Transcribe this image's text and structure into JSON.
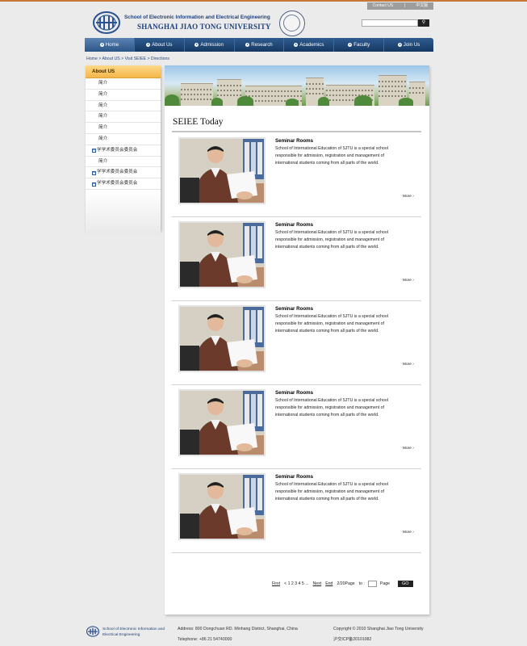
{
  "topbar": {
    "contact": "Contact US",
    "divider": "|",
    "chinese": "中文版"
  },
  "header": {
    "school": "School of Electronic Information and Electrical Engineering",
    "university": "SHANGHAI JIAO TONG UNIVERSITY"
  },
  "search": {
    "placeholder": "",
    "button": "⚲"
  },
  "nav": [
    {
      "label": "Home"
    },
    {
      "label": "About Us"
    },
    {
      "label": "Admission"
    },
    {
      "label": "Research"
    },
    {
      "label": "Academics"
    },
    {
      "label": "Faculty"
    },
    {
      "label": "Join Us"
    }
  ],
  "breadcrumb": "Home > About US > Visit SEIEE > Directions",
  "sidebar": {
    "title": "About US",
    "items": [
      {
        "label": "简介",
        "expandable": false
      },
      {
        "label": "简介",
        "expandable": false
      },
      {
        "label": "简介",
        "expandable": false
      },
      {
        "label": "简介",
        "expandable": false
      },
      {
        "label": "简介",
        "expandable": false
      },
      {
        "label": "简介",
        "expandable": false
      },
      {
        "label": "学学术委员会委员会",
        "expandable": true
      },
      {
        "label": "简介",
        "expandable": false
      },
      {
        "label": "学学术委员会委员会",
        "expandable": true
      },
      {
        "label": "学学术委员会委员会",
        "expandable": true
      }
    ]
  },
  "section": {
    "title": "SEIEE Today"
  },
  "items": [
    {
      "title": "Seminar Rooms",
      "desc": "School of International Education of SJTU is a special school responsible for admission, registration and management of international students coming from all parts of the world.",
      "more": "More ›"
    },
    {
      "title": "Seminar Rooms",
      "desc": "School of International Education of SJTU is a special school responsible for admission, registration and management of international students coming from all parts of the world.",
      "more": "More ›"
    },
    {
      "title": "Seminar Rooms",
      "desc": "School of International Education of SJTU is a special school responsible for admission, registration and management of international students coming from all parts of the world.",
      "more": "More ›"
    },
    {
      "title": "Seminar Rooms",
      "desc": "School of International Education of SJTU is a special school responsible for admission, registration and management of international students coming from all parts of the world.",
      "more": "More ›"
    },
    {
      "title": "Seminar Rooms",
      "desc": "School of International Education of SJTU is a special school responsible for admission, registration and management of international students coming from all parts of the world.",
      "more": "More ›"
    }
  ],
  "pager": {
    "first": "First",
    "prev": "< 1 2 3 4 5 ...",
    "next": "Next",
    "end": "End",
    "count": "2/20Page",
    "to": "to :",
    "page": "Page",
    "go": "GO"
  },
  "footer": {
    "school": "School of Electronic Information and Electrical Engineering",
    "address": "Address: 800 Dongchuan RD. Minhang District, Shanghai, China",
    "telephone": "Telephone: +86 21 54740000",
    "copyright": "Copyright © 2010 Shanghai Jiao Tong University",
    "icp": "沪交ICP备20101082"
  },
  "colors": {
    "nav": "#1f4a7c",
    "accent": "#f5b64a",
    "topline": "#c8773a"
  }
}
